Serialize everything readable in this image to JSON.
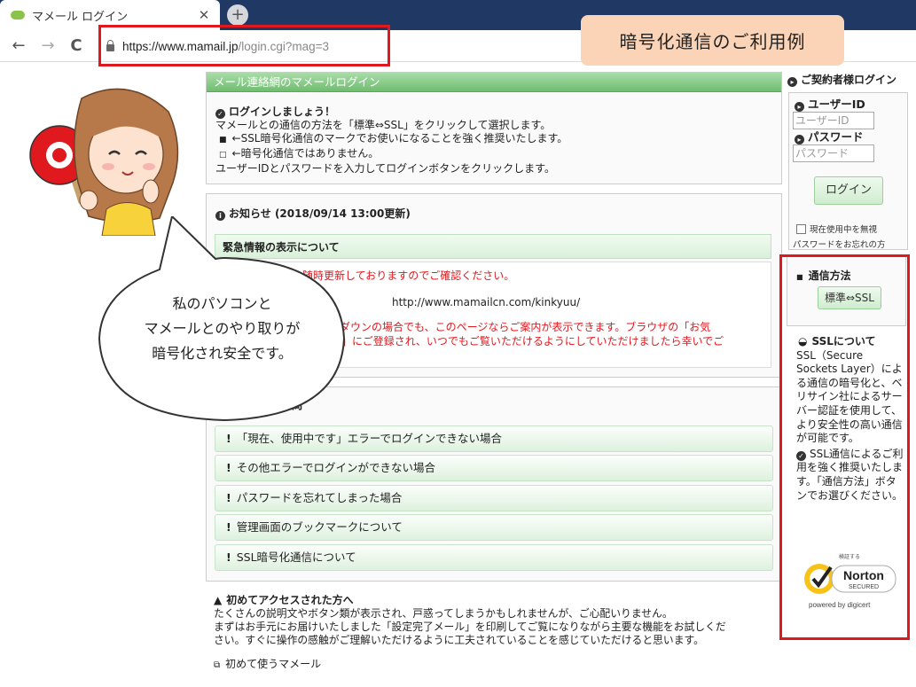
{
  "browser": {
    "tab_title": "マメール ログイン",
    "tab_close": "✕",
    "new_tab": "+",
    "url_host": "https://www.mamail.jp",
    "url_path": "/login.cgi?mag=3",
    "back": "←",
    "forward": "→",
    "reload": "C"
  },
  "callout": {
    "label": "暗号化通信のご利用例"
  },
  "main": {
    "header": "メール連絡網のマメールログイン",
    "intro": {
      "title": "ログインしましょう！",
      "lines": [
        "マメールとの通信の方法を「標準⇔SSL」をクリックして選択します。",
        "←SSL暗号化通信のマークでお使いになることを強く推奨いたします。",
        "←暗号化通信ではありません。",
        "ユーザーIDとパスワードを入力してログインボタンをクリックします。"
      ]
    },
    "news": {
      "title": "お知らせ (2018/09/14 13:00更新)",
      "subheader": "緊急情報の表示について",
      "red_line1": "を随時更新しておりますのでご確認ください。",
      "url": "http://www.mamailcn.com/kinkyuu/",
      "red_line2": "ーダウンの場合でも、このページならご案内が表示できます。ブラウザの「お気",
      "red_line3": "」にご登録され、いつでもご覧いただけるようにしていただけましたら幸いでご"
    },
    "faq": {
      "title_partial": "質問",
      "items": [
        "「現在、使用中です」エラーでログインできない場合",
        "その他エラーでログインができない場合",
        "パスワードを忘れてしまった場合",
        "管理画面のブックマークについて",
        "SSL暗号化通信について"
      ]
    },
    "first_access": {
      "title": "初めてアクセスされた方へ",
      "lines": [
        "たくさんの説明文やボタン類が表示され、戸惑ってしまうかもしれませんが、ご心配いりません。",
        "まずはお手元にお届けいたしました「設定完了メール」を印刷してご覧になりながら主要な機能をお試しくだ",
        "さい。すぐに操作の感触がご理解いただけるように工夫されていることを感じていただけると思います。"
      ],
      "link": "初めて使うマメール"
    }
  },
  "sidebar": {
    "title": "ご契約者様ログイン",
    "userid_label": "ユーザーID",
    "userid_placeholder": "ユーザーID",
    "password_label": "パスワード",
    "password_placeholder": "パスワード",
    "login_button": "ログイン",
    "checkbox_label": "現在使用中を無視",
    "forgot_link": "パスワードをお忘れの方",
    "method_title": "通信方法",
    "method_button": "標準⇔SSL",
    "ssl_title": "SSLについて",
    "ssl_body": "SSL（Secure Sockets Layer）による通信の暗号化と、ベリサイン社によるサーバー認証を使用して、より安全性の高い通信が可能です。",
    "ssl_recommend": "SSL通信によるご利用を強く推奨いたします。「通信方法」ボタンでお選びください。",
    "norton": {
      "top": "検証する",
      "name": "Norton",
      "secured": "SECURED",
      "powered": "powered by digicert"
    }
  },
  "bubble": {
    "lines": [
      "私のパソコンと",
      "マメールとのやり取りが",
      "暗号化され安全です。"
    ]
  },
  "colors": {
    "highlight_red": "#e0191f",
    "callout_bg": "#fbd3b6",
    "green_header": "#6fbd6f",
    "tabbar": "#1f3864"
  }
}
